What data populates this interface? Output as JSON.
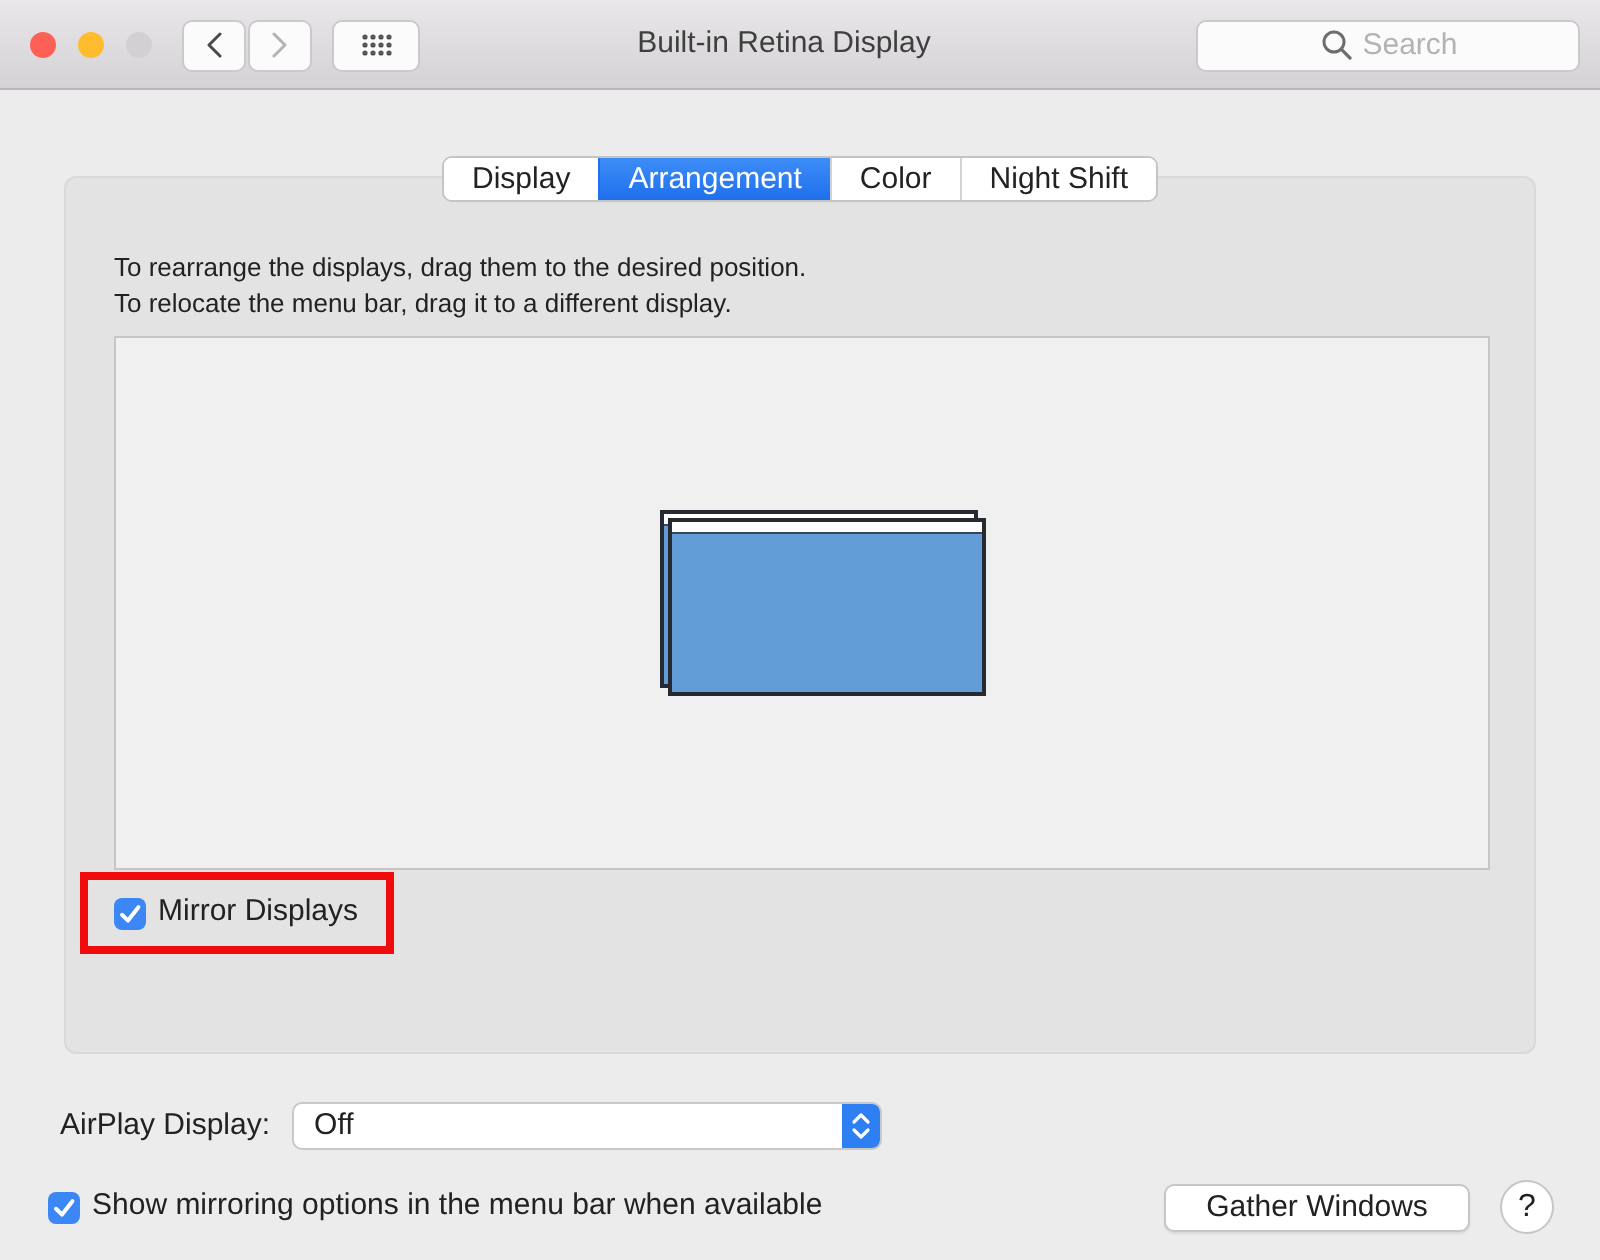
{
  "window": {
    "title": "Built-in Retina Display"
  },
  "window_controls": [
    {
      "color": "#fe5f57"
    },
    {
      "color": "#febc2e"
    },
    {
      "color": "#d2d0d2"
    }
  ],
  "navigation": [
    {
      "kind": "back",
      "disabled": false
    },
    {
      "kind": "forward",
      "disabled": true
    }
  ],
  "search": {
    "placeholder": "Search"
  },
  "tabs": [
    {
      "label": "Display",
      "selected": false
    },
    {
      "label": "Arrangement",
      "selected": true
    },
    {
      "label": "Color",
      "selected": false
    },
    {
      "label": "Night Shift",
      "selected": false
    }
  ],
  "arrangement": {
    "instructions": [
      "To rearrange the displays, drag them to the desired position.",
      "To relocate the menu bar, drag it to a different display."
    ]
  },
  "mirror_displays": {
    "label": "Mirror Displays",
    "checked": true,
    "highlighted": true
  },
  "airplay": {
    "label": "AirPlay Display:",
    "value": "Off"
  },
  "show_mirroring": {
    "label": "Show mirroring options in the menu bar when available",
    "checked": true
  },
  "buttons": [
    {
      "kind": "gather",
      "label": "Gather Windows"
    },
    {
      "kind": "help",
      "label": "?"
    }
  ]
}
